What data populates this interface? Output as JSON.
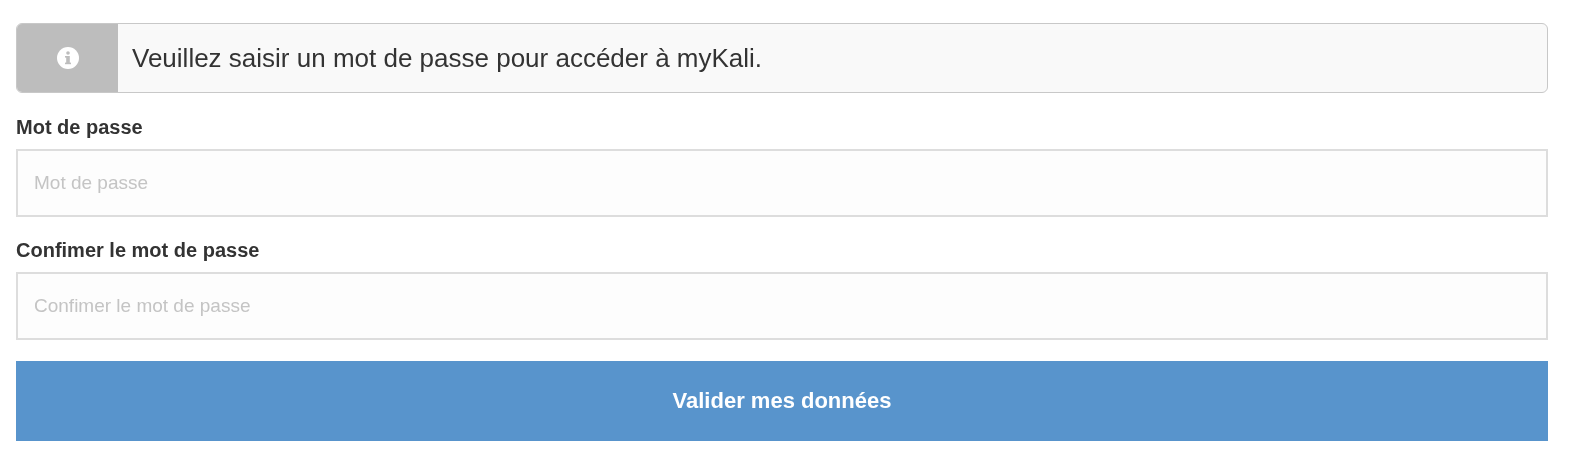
{
  "alert": {
    "kind": "info",
    "message": "Veuillez saisir un mot de passe pour accéder à myKali."
  },
  "fields": [
    {
      "label": "Mot de passe",
      "placeholder": "Mot de passe"
    },
    {
      "label": "Confimer le mot de passe",
      "placeholder": "Confimer le mot de passe"
    }
  ],
  "submit": {
    "label": "Valider mes données"
  }
}
